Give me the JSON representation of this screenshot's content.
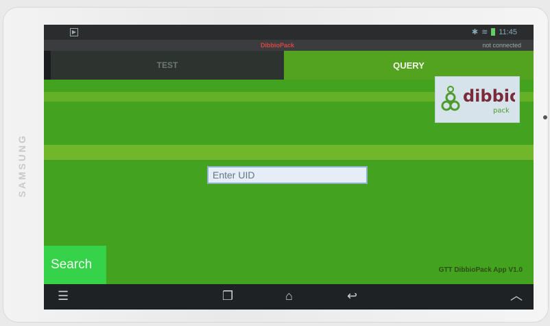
{
  "device": {
    "brand": "SAMSUNG"
  },
  "status_bar": {
    "time": "11:45"
  },
  "header": {
    "app_title": "DibbioPack",
    "connection_status": "not connected"
  },
  "tabs": [
    {
      "label": "TEST"
    },
    {
      "label": "QUERY"
    }
  ],
  "logo": {
    "text_main": "dibbio",
    "text_sub": "pack"
  },
  "form": {
    "uid_placeholder": "Enter UID"
  },
  "buttons": {
    "search_label": "Search"
  },
  "footer": {
    "version": "GTT DibbioPack App V1.0"
  },
  "colors": {
    "accent_green": "#43a31f",
    "button_green": "#36d24a",
    "title_red": "#dd4444"
  },
  "icons": [
    "picture-icon",
    "bluetooth-icon",
    "wifi-icon",
    "battery-icon",
    "menu-icon",
    "recent-apps-icon",
    "home-icon",
    "back-icon",
    "chevron-up-icon"
  ]
}
